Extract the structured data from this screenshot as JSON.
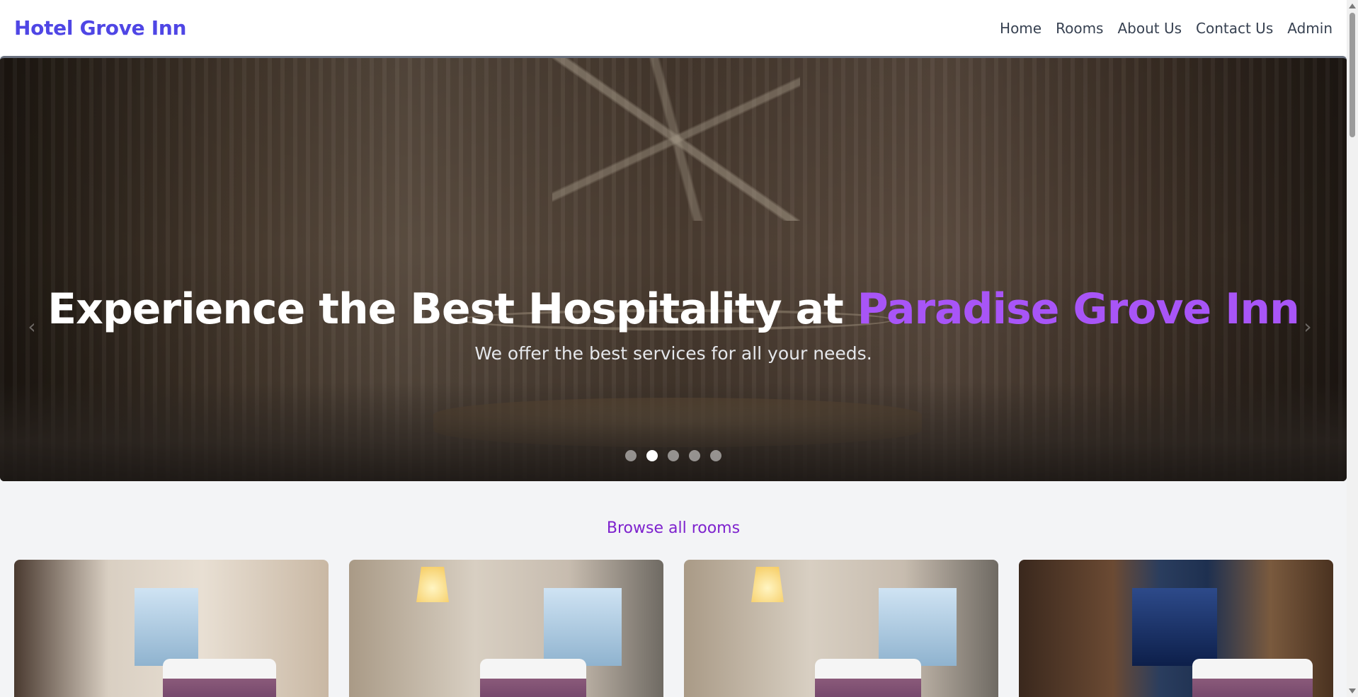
{
  "header": {
    "brand": "Hotel Grove Inn",
    "nav": [
      "Home",
      "Rooms",
      "About Us",
      "Contact Us",
      "Admin"
    ]
  },
  "hero": {
    "title_prefix": "Experience the Best Hospitality at ",
    "title_accent": "Paradise Grove Inn",
    "subtitle": "We offer the best services for all your needs.",
    "slide_count": 5,
    "active_slide": 2,
    "prev_icon": "chevron-left-icon",
    "next_icon": "chevron-right-icon"
  },
  "rooms": {
    "heading": "Browse all rooms",
    "cards": [
      "room-photo-1",
      "room-photo-2",
      "room-photo-3",
      "room-photo-4"
    ]
  },
  "colors": {
    "brand": "#4f46e5",
    "accent": "#a855f7",
    "link": "#7e22ce"
  }
}
